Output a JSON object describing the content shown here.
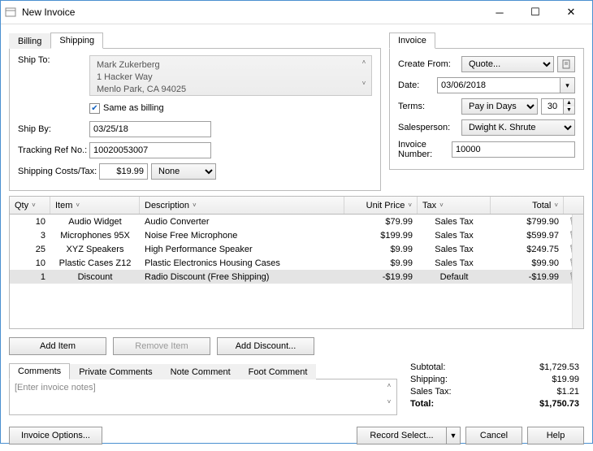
{
  "window": {
    "title": "New Invoice"
  },
  "ship_tabs": {
    "billing": "Billing",
    "shipping": "Shipping",
    "active": "Shipping"
  },
  "ship": {
    "to_label": "Ship To:",
    "addr_line1": "Mark Zukerberg",
    "addr_line2": "1 Hacker Way",
    "addr_line3": "Menlo Park, CA 94025",
    "same_as_billing": "Same as billing",
    "ship_by_label": "Ship By:",
    "ship_by_value": "03/25/18",
    "tracking_label": "Tracking Ref No.:",
    "tracking_value": "10020053007",
    "cost_label": "Shipping Costs/Tax:",
    "cost_value": "$19.99",
    "cost_tax": "None"
  },
  "invoice_tab": "Invoice",
  "invoice": {
    "create_from_label": "Create From:",
    "create_from_value": "Quote...",
    "date_label": "Date:",
    "date_value": "03/06/2018",
    "terms_label": "Terms:",
    "terms_value": "Pay in Days",
    "terms_days": "30",
    "salesperson_label": "Salesperson:",
    "salesperson_value": "Dwight K. Shrute",
    "number_label": "Invoice Number:",
    "number_value": "10000"
  },
  "grid": {
    "headers": {
      "qty": "Qty",
      "item": "Item",
      "desc": "Description",
      "price": "Unit Price",
      "tax": "Tax",
      "total": "Total"
    },
    "rows": [
      {
        "qty": "10",
        "item": "Audio Widget",
        "desc": "Audio Converter",
        "price": "$79.99",
        "tax": "Sales Tax",
        "total": "$799.90"
      },
      {
        "qty": "3",
        "item": "Microphones 95X",
        "desc": "Noise Free Microphone",
        "price": "$199.99",
        "tax": "Sales Tax",
        "total": "$599.97"
      },
      {
        "qty": "25",
        "item": "XYZ Speakers",
        "desc": "High Performance Speaker",
        "price": "$9.99",
        "tax": "Sales Tax",
        "total": "$249.75"
      },
      {
        "qty": "10",
        "item": "Plastic Cases Z12",
        "desc": "Plastic Electronics Housing Cases",
        "price": "$9.99",
        "tax": "Sales Tax",
        "total": "$99.90"
      },
      {
        "qty": "1",
        "item": "Discount",
        "desc": "Radio Discount (Free Shipping)",
        "price": "-$19.99",
        "tax": "Default",
        "total": "-$19.99"
      }
    ]
  },
  "buttons": {
    "add_item": "Add Item",
    "remove_item": "Remove Item",
    "add_discount": "Add Discount..."
  },
  "comment_tabs": {
    "comments": "Comments",
    "private": "Private Comments",
    "note": "Note Comment",
    "foot": "Foot Comment"
  },
  "comments_placeholder": "[Enter invoice notes]",
  "totals": {
    "subtotal_label": "Subtotal:",
    "subtotal_value": "$1,729.53",
    "shipping_label": "Shipping:",
    "shipping_value": "$19.99",
    "tax_label": "Sales Tax:",
    "tax_value": "$1.21",
    "total_label": "Total:",
    "total_value": "$1,750.73"
  },
  "footer": {
    "invoice_options": "Invoice Options...",
    "record": "Record Select...",
    "cancel": "Cancel",
    "help": "Help"
  }
}
